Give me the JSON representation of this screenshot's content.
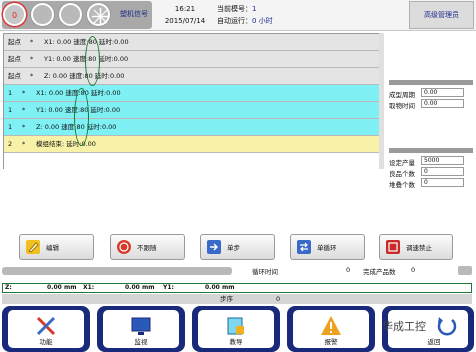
{
  "header": {
    "alarm_indicator": "0",
    "machine_status": "塑机信号",
    "time": "16:21",
    "date": "2015/07/14",
    "mold_label": "当前模号：",
    "mold_value": "1",
    "auto_run_label": "自动运行：",
    "auto_run_value": "0 小时",
    "admin_button": "高级管理员"
  },
  "program_rows": [
    {
      "num": "起点",
      "mark": "*",
      "text": "X1: 0.00 速度:80 延时:0.00",
      "style": "gray"
    },
    {
      "num": "起点",
      "mark": "*",
      "text": "Y1: 0.00 速度:80 延时:0.00",
      "style": "gray"
    },
    {
      "num": "起点",
      "mark": "*",
      "text": "Z: 0.00 速度:80 延时:0.00",
      "style": "gray"
    },
    {
      "num": "1",
      "mark": "*",
      "text": "X1: 0.00 速度:80 延时:0.00",
      "style": "cyan"
    },
    {
      "num": "1",
      "mark": "*",
      "text": "Y1: 0.00 速度:80 延时:0.00",
      "style": "cyan"
    },
    {
      "num": "1",
      "mark": "*",
      "text": "Z: 0.00 速度:80 延时:0.00",
      "style": "cyan"
    },
    {
      "num": "2",
      "mark": "*",
      "text": "模组结束: 延时:0.00",
      "style": "yellow"
    }
  ],
  "right_panel": {
    "molding_cycle_label": "成型周期",
    "molding_cycle_value": "0.00",
    "pickup_time_label": "取物时间",
    "pickup_time_value": "0.00",
    "set_output_label": "设定产量",
    "set_output_value": "5000",
    "good_count_label": "良品个数",
    "good_count_value": "0",
    "stack_count_label": "堆叠个数",
    "stack_count_value": "0"
  },
  "buttons": {
    "edit": "编辑",
    "no_follow": "不跟随",
    "single_step": "单步",
    "single_cycle": "单循环",
    "adjust_disable": "调速禁止"
  },
  "stats": {
    "cycle_time_label": "循环时间",
    "cycle_time_value": "0",
    "finished_label": "完成产品数",
    "finished_value": "0"
  },
  "axis_readout": {
    "z_label": "Z:",
    "z_value": "0.00",
    "z_unit": "mm",
    "x1_label": "X1:",
    "x1_value": "0.00",
    "x1_unit": "mm",
    "y1_label": "Y1:",
    "y1_value": "0.00",
    "y1_unit": "mm"
  },
  "step": {
    "label": "步序",
    "value": "0"
  },
  "nav": {
    "function": "功能",
    "monitor": "监视",
    "teach": "教导",
    "alarm": "报警",
    "back": "返回"
  },
  "watermark": "华成工控",
  "colors": {
    "row_gray": "#e4e4e4",
    "row_cyan": "#7ff0f4",
    "row_yellow": "#f8f2a8",
    "nav_frame": "#1a2a7a",
    "annotation_green": "#1f7a3a"
  },
  "icons": {
    "edit": "edit-icon",
    "no_follow": "no-follow-icon",
    "single_step": "step-icon",
    "single_cycle": "cycle-icon",
    "adjust_disable": "adjust-icon",
    "function": "tools-icon",
    "monitor": "monitor-icon",
    "teach": "teach-icon",
    "alarm": "warning-icon",
    "back": "back-icon"
  }
}
